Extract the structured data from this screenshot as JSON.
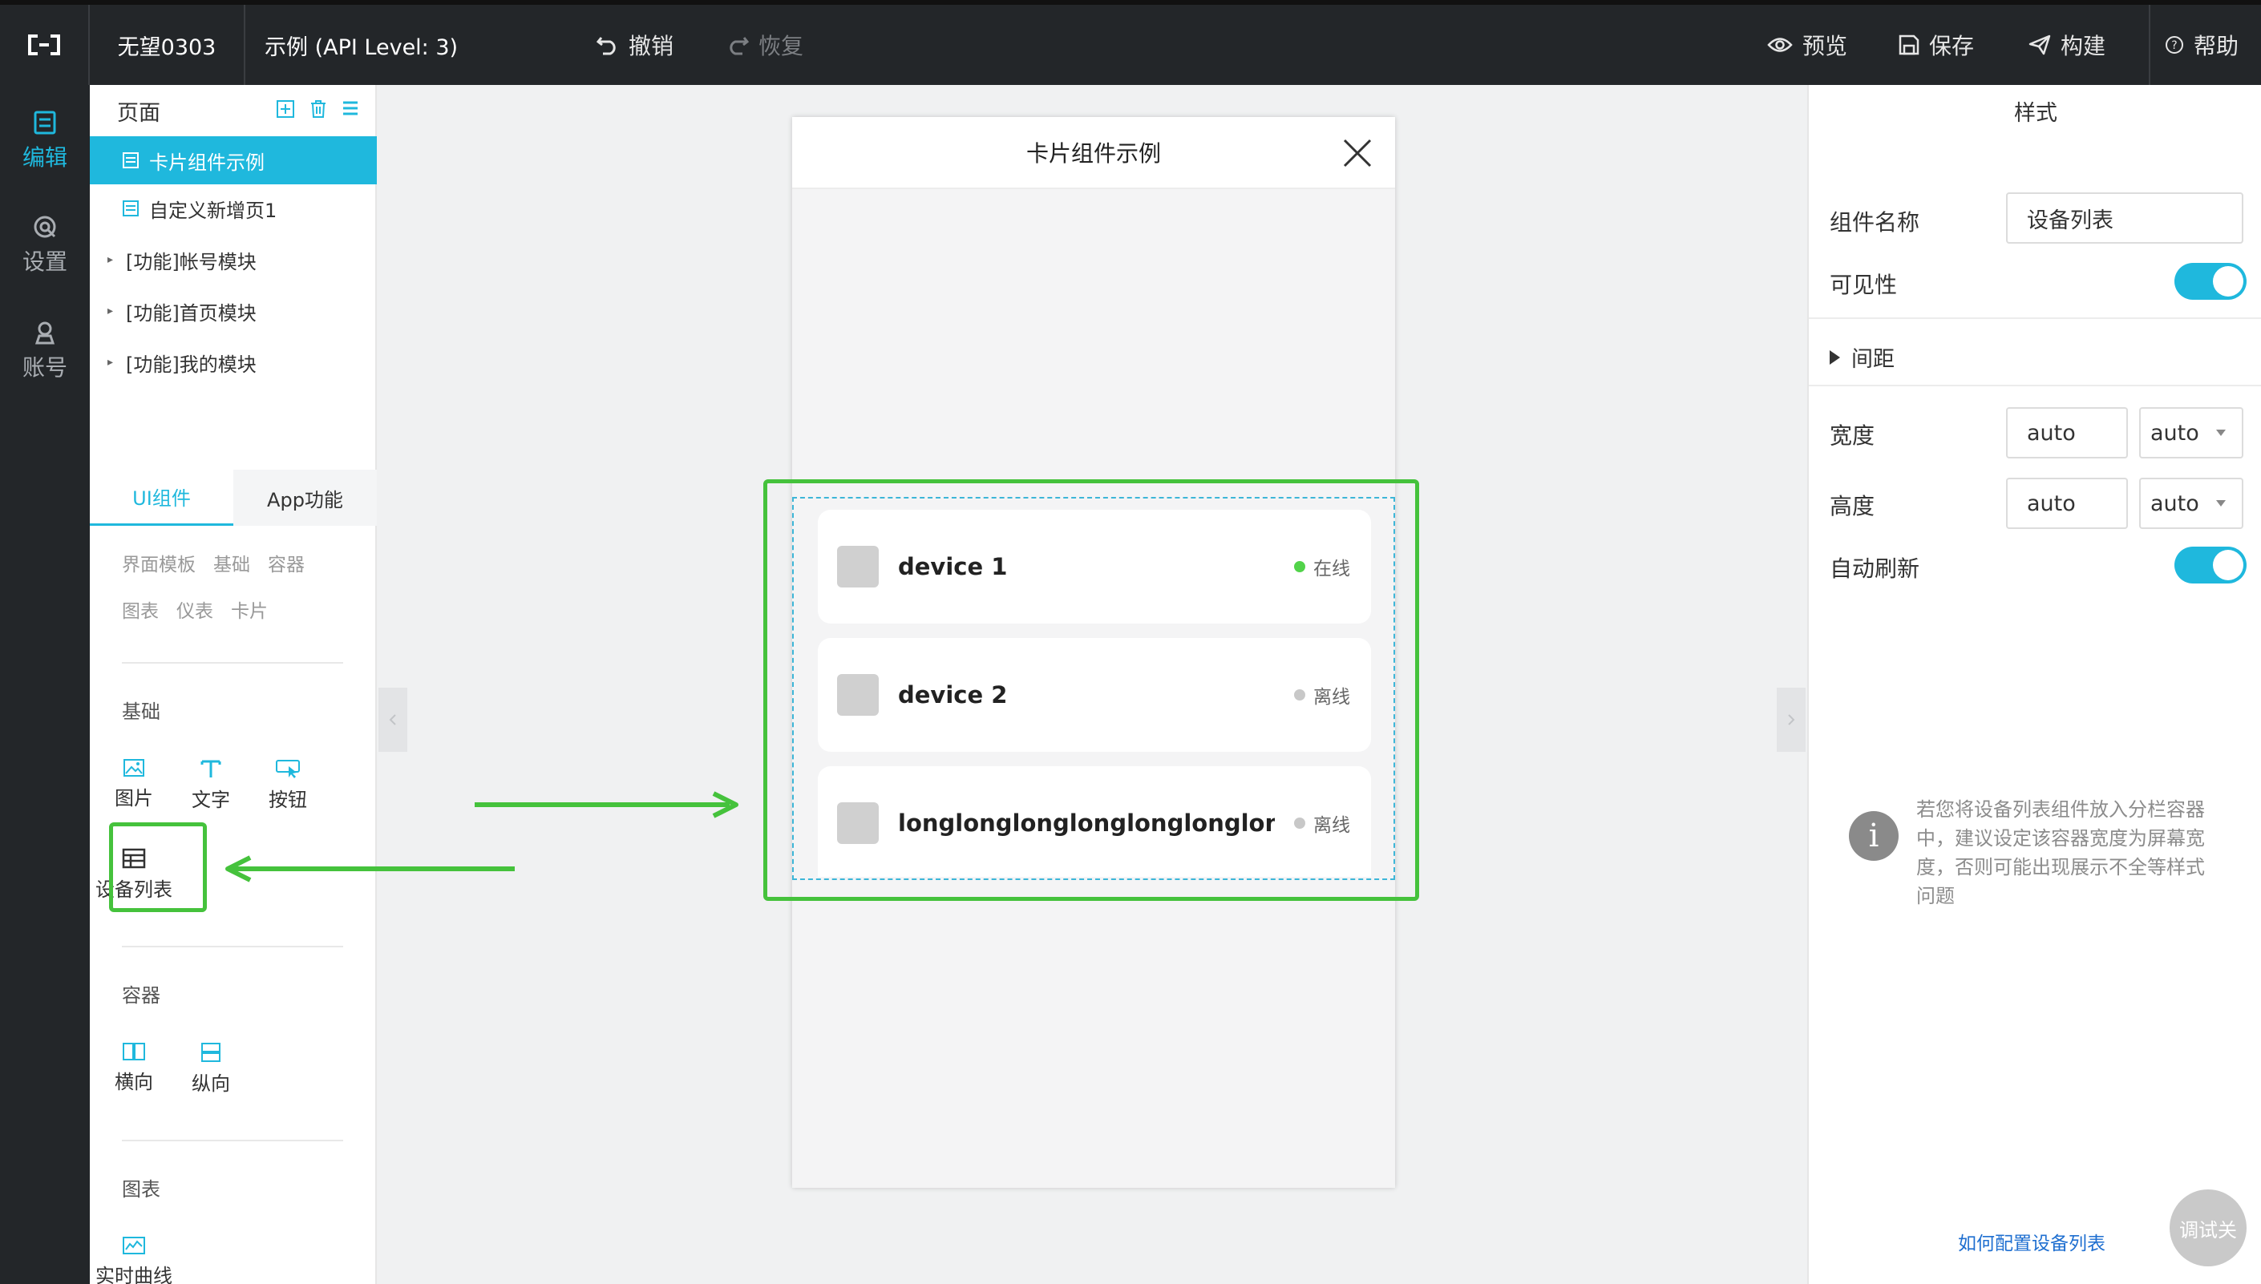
{
  "topbar": {
    "project_name": "无望0303",
    "app_title": "示例 (API Level: 3)",
    "undo": "撤销",
    "redo": "恢复",
    "preview": "预览",
    "save": "保存",
    "build": "构建",
    "help": "帮助"
  },
  "leftnav": {
    "edit": "编辑",
    "settings": "设置",
    "account": "账号"
  },
  "pages": {
    "header": "页面",
    "items": [
      {
        "label": "卡片组件示例"
      },
      {
        "label": "自定义新增页1"
      },
      {
        "label": "[功能]帐号模块"
      },
      {
        "label": "[功能]首页模块"
      },
      {
        "label": "[功能]我的模块"
      }
    ]
  },
  "components": {
    "tab_ui": "UI组件",
    "tab_app": "App功能",
    "cats": [
      "界面模板",
      "基础",
      "容器",
      "图表",
      "仪表",
      "卡片"
    ],
    "basic_title": "基础",
    "basic_items": [
      "图片",
      "文字",
      "按钮",
      "设备列表"
    ],
    "container_title": "容器",
    "container_items": [
      "横向",
      "纵向"
    ],
    "chart_title": "图表",
    "chart_items": [
      "实时曲线"
    ]
  },
  "phone": {
    "title": "卡片组件示例",
    "devices": [
      {
        "name": "device 1",
        "status": "在线",
        "status_color": "#52d34a"
      },
      {
        "name": "device 2",
        "status": "离线",
        "status_color": "#c8c8c8"
      },
      {
        "name": "longlonglonglonglonglonglonglo...",
        "status": "离线",
        "status_color": "#c8c8c8"
      }
    ]
  },
  "props": {
    "title": "样式",
    "name_label": "组件名称",
    "name_value": "设备列表",
    "visible_label": "可见性",
    "visible_on": true,
    "spacing_label": "间距",
    "width_label": "宽度",
    "width_value": "auto",
    "width_unit": "auto",
    "height_label": "高度",
    "height_value": "auto",
    "height_unit": "auto",
    "autorefresh_label": "自动刷新",
    "autorefresh_on": true,
    "info_text": "若您将设备列表组件放入分栏容器中，建议设定该容器宽度为屏幕宽度，否则可能出现展示不全等样式问题",
    "help_link": "如何配置设备列表",
    "debug_button": "调试关"
  },
  "colors": {
    "accent": "#1fb8dd",
    "highlight": "#45c23c",
    "online": "#52d34a",
    "offline": "#c8c8c8"
  }
}
